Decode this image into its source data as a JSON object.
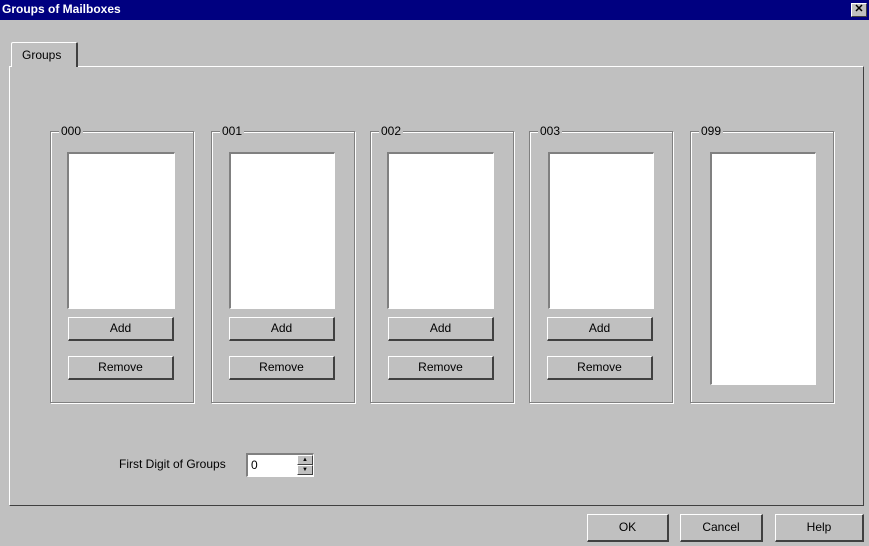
{
  "window": {
    "title": "Groups of Mailboxes"
  },
  "tabs": [
    {
      "label": "Groups"
    }
  ],
  "groups": [
    {
      "label": "000",
      "add_label": "Add",
      "remove_label": "Remove"
    },
    {
      "label": "001",
      "add_label": "Add",
      "remove_label": "Remove"
    },
    {
      "label": "002",
      "add_label": "Add",
      "remove_label": "Remove"
    },
    {
      "label": "003",
      "add_label": "Add",
      "remove_label": "Remove"
    },
    {
      "label": "099"
    }
  ],
  "first_digit": {
    "label": "First Digit of Groups",
    "value": "0"
  },
  "footer": {
    "ok_label": "OK",
    "cancel_label": "Cancel",
    "help_label": "Help"
  },
  "colors": {
    "title_bar": "#000080",
    "face": "#c0c0c0",
    "list_bg": "#ffffff"
  }
}
